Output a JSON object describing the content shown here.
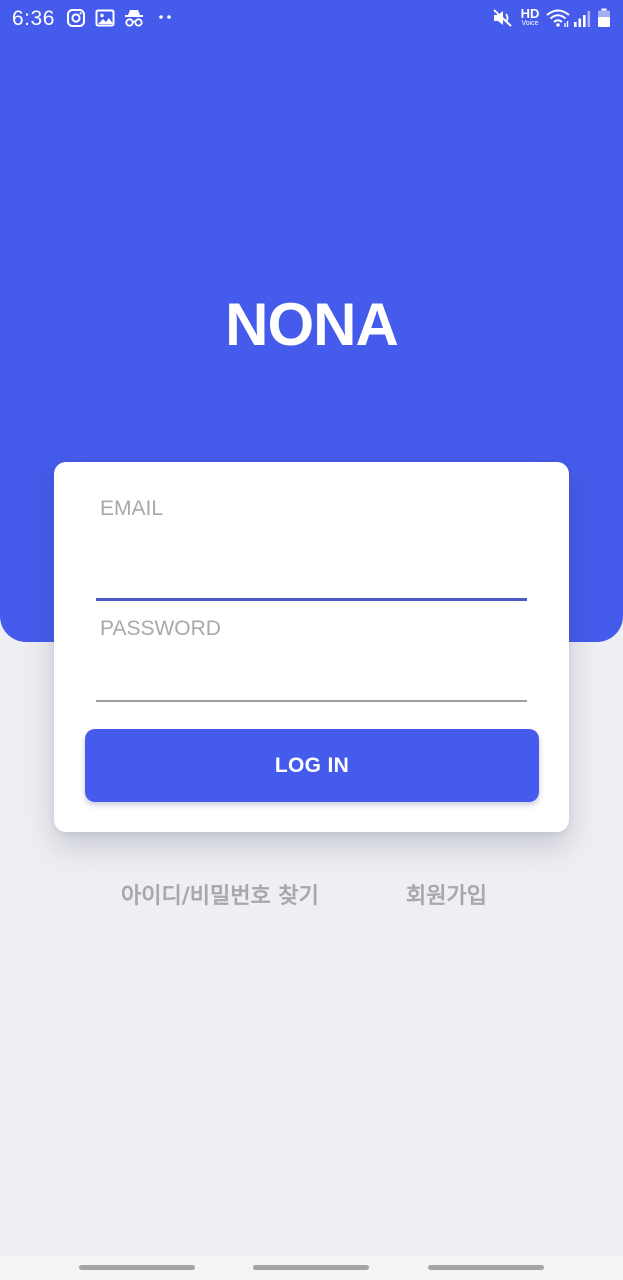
{
  "status_bar": {
    "time": "6:36",
    "left_icons": [
      "instagram-icon",
      "gallery-icon",
      "incognito-icon",
      "more-dots-icon"
    ],
    "right_icons": [
      "mute-icon",
      "hd-voice-icon",
      "wifi-icon",
      "signal-icon",
      "battery-icon"
    ],
    "hd_label": "HD",
    "voice_label": "Voice"
  },
  "brand": {
    "name": "NONA"
  },
  "login_form": {
    "email_label": "EMAIL",
    "email_value": "",
    "password_label": "PASSWORD",
    "password_value": "",
    "submit_label": "LOG IN"
  },
  "links": {
    "find_account": "아이디/비밀번호 찾기",
    "sign_up": "회원가입"
  },
  "colors": {
    "primary": "#455beb",
    "background": "#eeeff3",
    "label_gray": "#a9a9ad",
    "active_underline": "#4a5ac4"
  }
}
